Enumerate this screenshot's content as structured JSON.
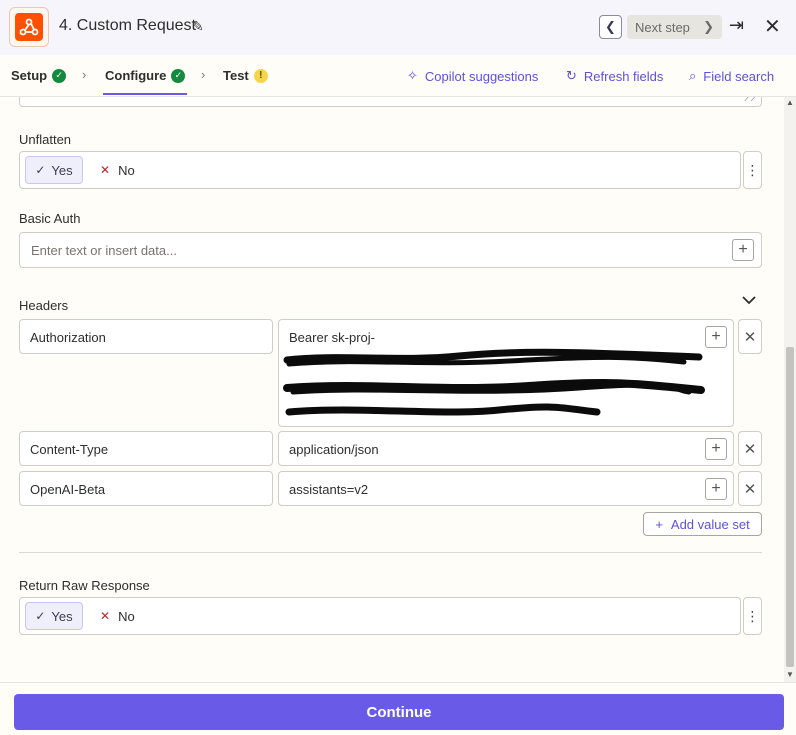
{
  "header": {
    "step_title": "4. Custom Request",
    "next_step_label": "Next step"
  },
  "tabs": [
    {
      "label": "Setup",
      "status": "complete"
    },
    {
      "label": "Configure",
      "status": "complete"
    },
    {
      "label": "Test",
      "status": "warning"
    }
  ],
  "actions": {
    "copilot": "Copilot suggestions",
    "refresh": "Refresh fields",
    "search": "Field search"
  },
  "fields": {
    "unflatten": {
      "label": "Unflatten",
      "yes": "Yes",
      "no": "No",
      "selected": "Yes"
    },
    "basic_auth": {
      "label": "Basic Auth",
      "placeholder": "Enter text or insert data..."
    },
    "headers": {
      "label": "Headers",
      "rows": [
        {
          "key": "Authorization",
          "value": "Bearer sk-proj-"
        },
        {
          "key": "Content-Type",
          "value": "application/json"
        },
        {
          "key": "OpenAI-Beta",
          "value": "assistants=v2"
        }
      ],
      "add_label": "Add value set"
    },
    "raw_response": {
      "label": "Return Raw Response",
      "yes": "Yes",
      "no": "No",
      "selected": "Yes"
    }
  },
  "footer": {
    "continue_label": "Continue"
  },
  "colors": {
    "accent": "#695be8",
    "brand": "#ff4f00",
    "success": "#138a3d",
    "warning": "#f6d54a"
  }
}
